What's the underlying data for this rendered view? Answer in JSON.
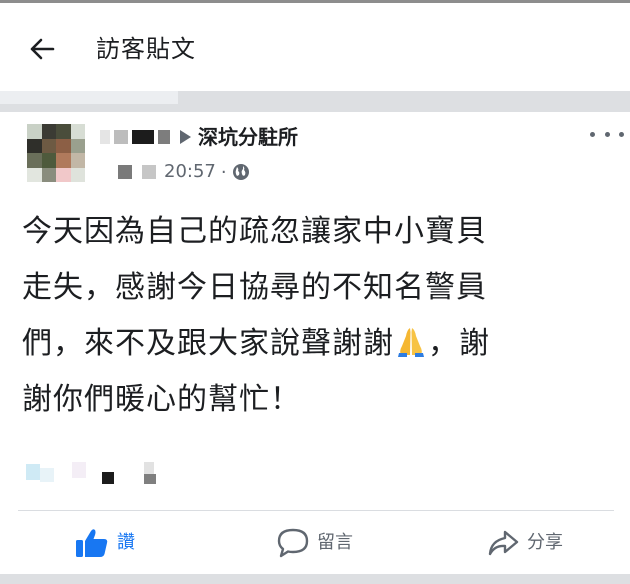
{
  "header": {
    "title": "訪客貼文",
    "back_icon": "arrow-left-icon"
  },
  "post": {
    "page_name": "深坑分駐所",
    "timestamp": "20:57",
    "separator": "·",
    "privacy_icon": "globe-icon",
    "menu_icon": "more-horizontal-icon",
    "text_lines": [
      "今天因為自己的疏忽讓家中小寶貝",
      "走失，感謝今日協尋的不知名警員",
      "們，來不及跟大家說聲謝謝",
      "，謝",
      "謝你們暖心的幫忙！"
    ],
    "emoji": "folded-hands-emoji"
  },
  "actions": {
    "like_label": "讚",
    "comment_label": "留言",
    "share_label": "分享",
    "like_color": "#1877f2",
    "muted_color": "#606770"
  }
}
